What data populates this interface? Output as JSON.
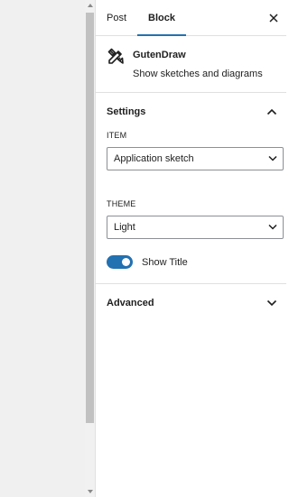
{
  "tabs": [
    {
      "label": "Post",
      "active": false
    },
    {
      "label": "Block",
      "active": true
    }
  ],
  "block": {
    "icon": "pencil-ruler-icon",
    "title": "GutenDraw",
    "description": "Show sketches and diagrams"
  },
  "settings": {
    "title": "Settings",
    "expanded": true,
    "item": {
      "label": "ITEM",
      "value": "Application sketch"
    },
    "theme": {
      "label": "THEME",
      "value": "Light"
    },
    "show_title": {
      "label": "Show Title",
      "checked": true
    }
  },
  "advanced": {
    "title": "Advanced",
    "expanded": false
  },
  "colors": {
    "accent": "#2271b1",
    "border": "#e0e0e0",
    "canvas": "#f0f0f0"
  }
}
